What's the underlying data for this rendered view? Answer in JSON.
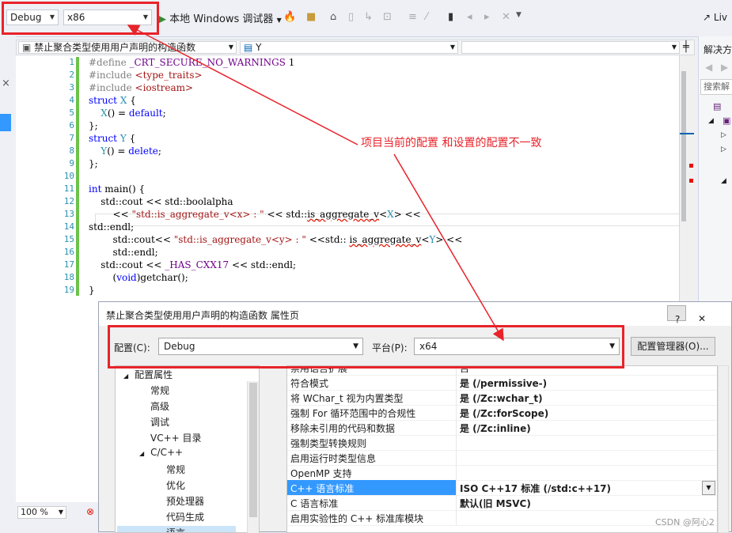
{
  "toolbar": {
    "config": "Debug",
    "platform": "x86",
    "debugger": "本地 Windows 调试器",
    "live": "Liv"
  },
  "navbar": {
    "scope": "禁止聚合类型使用用户声明的构造函数",
    "member": "Y"
  },
  "editor": {
    "line_numbers": [
      "1",
      "2",
      "3",
      "4",
      "5",
      "6",
      "7",
      "8",
      "9",
      "10",
      "11",
      "12",
      "13",
      "14",
      "15",
      "16",
      "17",
      "18",
      "19"
    ],
    "annotation": "项目当前的配置 和设置的配置不一致",
    "zoom": "100 %"
  },
  "solution_explorer": {
    "title": "解决方",
    "search": "搜索解"
  },
  "dialog": {
    "title": "禁止聚合类型使用用户声明的构造函数 属性页",
    "help": "?",
    "config_label": "配置(C):",
    "config_value": "Debug",
    "platform_label": "平台(P):",
    "platform_value": "x64",
    "config_manager": "配置管理器(O)...",
    "tree": [
      {
        "label": "配置属性",
        "arrow": "◢"
      },
      {
        "label": "常规"
      },
      {
        "label": "高级"
      },
      {
        "label": "调试"
      },
      {
        "label": "VC++ 目录"
      },
      {
        "label": "C/C++",
        "arrow": "◢"
      },
      {
        "label": "常规"
      },
      {
        "label": "优化"
      },
      {
        "label": "预处理器"
      },
      {
        "label": "代码生成"
      },
      {
        "label": "语言"
      }
    ],
    "props": [
      {
        "name": "禁用语言扩展",
        "value": "否"
      },
      {
        "name": "符合模式",
        "value": "是 (/permissive-)"
      },
      {
        "name": "将 WChar_t 视为内置类型",
        "value": "是 (/Zc:wchar_t)"
      },
      {
        "name": "强制 For 循环范围中的合规性",
        "value": "是 (/Zc:forScope)"
      },
      {
        "name": "移除未引用的代码和数据",
        "value": "是 (/Zc:inline)"
      },
      {
        "name": "强制类型转换规则",
        "value": ""
      },
      {
        "name": "启用运行时类型信息",
        "value": ""
      },
      {
        "name": "OpenMP 支持",
        "value": ""
      },
      {
        "name": "C++ 语言标准",
        "value": "ISO C++17 标准 (/std:c++17)"
      },
      {
        "name": "C 语言标准",
        "value": "默认(旧 MSVC)"
      },
      {
        "name": "启用实验性的 C++ 标准库模块",
        "value": ""
      }
    ]
  },
  "watermark": "CSDN @阿心2"
}
